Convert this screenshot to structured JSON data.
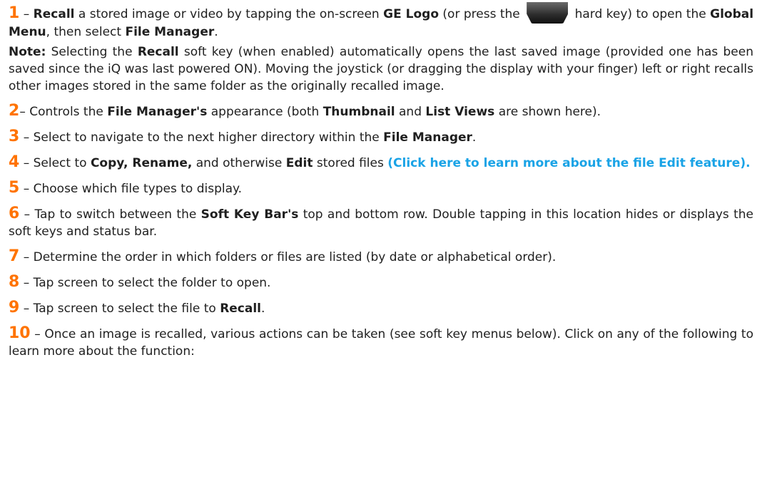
{
  "items": [
    {
      "num": "1",
      "parts": [
        "Recall",
        "a stored image or video by tapping the on-screen",
        "GE Logo",
        "(or press the",
        "hard key) to open the",
        "Global Menu",
        ", then select",
        "File Manager",
        "."
      ]
    },
    {
      "note_label": "Note:",
      "parts": [
        "Selecting the",
        "Recall",
        "soft key (when enabled) automatically opens the last saved image (provided one has been saved since the iQ was last powered ON). Moving the joystick (or dragging the display with your finger) left or right recalls other images stored in the same folder as the originally recalled image."
      ]
    },
    {
      "num": "2",
      "parts": [
        "Controls the",
        "File Manager's",
        "appearance (both",
        "Thumbnail",
        "and",
        "List Views",
        "are shown here)."
      ]
    },
    {
      "num": "3",
      "parts": [
        "Select to navigate to the next higher directory within the",
        "File Manager",
        "."
      ]
    },
    {
      "num": "4",
      "parts": [
        "Select to",
        "Copy, Rename,",
        "and otherwise",
        "Edit",
        "stored files",
        "(Click here to learn more about the file Edit feature)."
      ]
    },
    {
      "num": "5",
      "parts": [
        "Choose which file types to display."
      ]
    },
    {
      "num": "6",
      "parts": [
        "Tap to switch between the",
        "Soft Key Bar's",
        "top and bottom row.  Double tapping in this location hides or displays the soft keys and status bar."
      ]
    },
    {
      "num": "7",
      "parts": [
        "Determine the order in which folders or files are listed (by date or alphabetical order)."
      ]
    },
    {
      "num": "8",
      "parts": [
        "Tap screen to select the folder to open."
      ]
    },
    {
      "num": "9",
      "parts": [
        "Tap screen to select the file to",
        "Recall",
        "."
      ]
    },
    {
      "num": "10",
      "parts": [
        "Once an image is recalled, various actions can be taken (see soft key menus below). Click on any of the following to learn more about the function:"
      ]
    }
  ],
  "dash": "–",
  "hard_key_icon": "ge-logo-hard-key-icon"
}
